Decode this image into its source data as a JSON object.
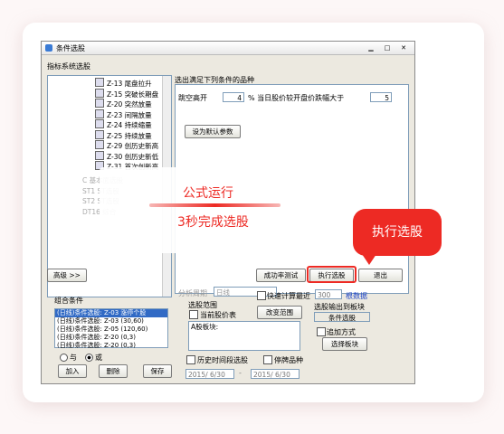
{
  "window": {
    "title": "条件选股"
  },
  "left": {
    "header": "指标系统选股",
    "items": [
      {
        "code": "Z-13",
        "name": "尾盘拉升"
      },
      {
        "code": "Z-15",
        "name": "突破长期盘"
      },
      {
        "code": "Z-20",
        "name": "突然放量"
      },
      {
        "code": "Z-23",
        "name": "间隔放量"
      },
      {
        "code": "Z-24",
        "name": "持续缩量"
      },
      {
        "code": "Z-25",
        "name": "持续放量"
      },
      {
        "code": "Z-29",
        "name": "创历史新高"
      },
      {
        "code": "Z-30",
        "name": "创历史新低"
      },
      {
        "code": "Z-31",
        "name": "首次创新高"
      }
    ],
    "blurred": [
      "C 基本面选股",
      "ST1 ST选股",
      "ST2 ST选股",
      "DT16 综合"
    ]
  },
  "main": {
    "title": "选出满足下列条件的品种",
    "param1_label": "跳空高开",
    "param1_value": "4",
    "param2_label": "% 当日股价较开盘价跌幅大于",
    "param2_value": "5",
    "set_default": "设为默认参数",
    "period_label": "分析周期",
    "period_value": "日线"
  },
  "overlay": {
    "line1": "公式运行",
    "line2": "3秒完成选股"
  },
  "callout": "执行选股",
  "buttons": {
    "advanced": "高级 >>",
    "success_test": "成功率测试",
    "execute": "执行选股",
    "exit": "退出",
    "add": "加入",
    "delete": "删除",
    "save": "保存",
    "change_range": "改变范围",
    "select_block": "选择板块"
  },
  "combo": {
    "title": "组合条件",
    "items": [
      "(日线)条件选股: Z-03 涨停个股",
      "(日线)条件选股: Z-03 (30,60)",
      "(日线)条件选股: Z-05 (120,60)",
      "(日线)条件选股: Z-20 (0,3)",
      "(日线)条件选股: Z-20 (0,3)"
    ],
    "and_label": "与",
    "or_label": "或"
  },
  "range": {
    "title": "选股范围",
    "current_price": "当前股价表",
    "stock_block": "A股板块:",
    "fast_calc": "快速计算最近",
    "fast_num": "300",
    "fast_unit": "根数据",
    "output_label": "选股输出到板块",
    "output_value": "条件选股",
    "append": "追加方式",
    "history": "历史时间段选股",
    "exclude": "停牌品种",
    "date_from": "2015/ 6/30",
    "date_to": "2015/ 6/30",
    "dash": "-"
  },
  "colors": {
    "accent": "#ed2a24",
    "select": "#316ac5"
  }
}
